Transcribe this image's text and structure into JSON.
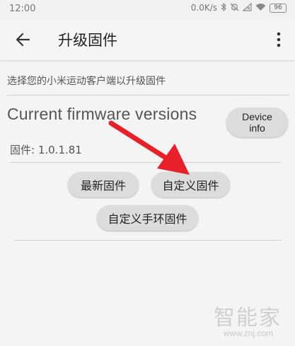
{
  "status_bar": {
    "time": "12:00",
    "network_speed": "0.0K/s",
    "battery_level": "96",
    "icons": [
      "bluetooth-icon",
      "mute-icon",
      "signal-off-icon",
      "wifi-icon",
      "battery-icon"
    ]
  },
  "app_bar": {
    "title": "升级固件",
    "back_icon": "arrow-left-icon",
    "overflow_icon": "more-vertical-icon"
  },
  "hint_text": "选择您的小米运动客户端以升级固件",
  "firmware": {
    "section_title": "Current firmware versions",
    "device_info_button": "Device info",
    "version_label": "固件: 1.0.1.81"
  },
  "actions": {
    "latest_firmware": "最新固件",
    "custom_firmware": "自定义固件",
    "custom_band_firmware": "自定义手环固件"
  },
  "annotation": {
    "arrow_color": "#e8202a"
  },
  "watermark": {
    "brand": "智能家",
    "url": "www.znj.com"
  },
  "colors": {
    "background": "#f4f4f4",
    "button": "#dcdcdc",
    "divider": "#cfcfcf"
  }
}
